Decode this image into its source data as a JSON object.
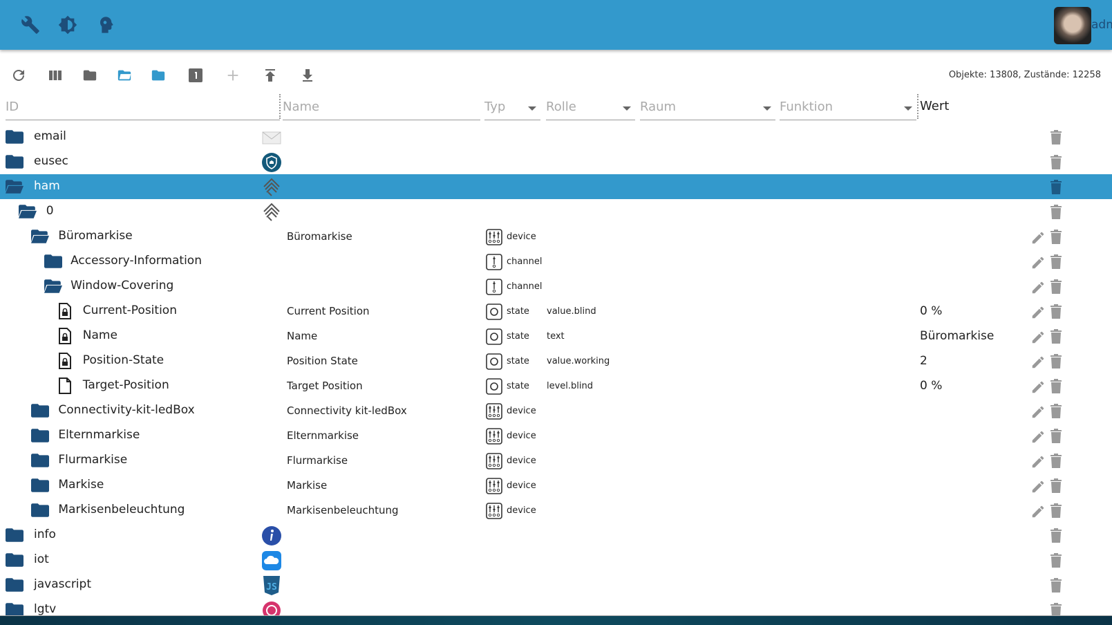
{
  "header": {
    "user": "adm",
    "icons": [
      "wrench-icon",
      "brightness-icon",
      "expert-mode-icon"
    ]
  },
  "toolbar": {
    "buttons": [
      "refresh",
      "columns",
      "collapse-all",
      "expand-all",
      "expand-one",
      "numbering",
      "add",
      "upload",
      "download"
    ],
    "stats": "Objekte: 13808, Zustände: 12258"
  },
  "filters": {
    "id": "ID",
    "name": "Name",
    "type": "Typ",
    "role": "Rolle",
    "room": "Raum",
    "function": "Funktion",
    "value": "Wert"
  },
  "colors": {
    "accent": "#3399cc",
    "folder": "#1d4e7a"
  },
  "rows": [
    {
      "id": "email",
      "level": 0,
      "icon": "folder",
      "adapter": "email",
      "editable": false
    },
    {
      "id": "eusec",
      "level": 0,
      "icon": "folder",
      "adapter": "eusec",
      "editable": false
    },
    {
      "id": "ham",
      "level": 0,
      "icon": "folder-open",
      "adapter": "ham",
      "selected": true,
      "editable": false
    },
    {
      "id": "0",
      "level": 1,
      "icon": "folder-open",
      "adapter": "ham",
      "editable": false
    },
    {
      "id": "Büromarkise",
      "level": 2,
      "icon": "folder-open",
      "name": "Büromarkise",
      "type": "device",
      "editable": true
    },
    {
      "id": "Accessory-Information",
      "level": 3,
      "icon": "folder",
      "type": "channel",
      "editable": true
    },
    {
      "id": "Window-Covering",
      "level": 3,
      "icon": "folder-open",
      "type": "channel",
      "editable": true
    },
    {
      "id": "Current-Position",
      "level": 4,
      "icon": "file-lock",
      "name": "Current Position",
      "type": "state",
      "role": "value.blind",
      "value": "0 %",
      "editable": true
    },
    {
      "id": "Name",
      "level": 4,
      "icon": "file-lock",
      "name": "Name",
      "type": "state",
      "role": "text",
      "value": "Büromarkise",
      "editable": true
    },
    {
      "id": "Position-State",
      "level": 4,
      "icon": "file-lock",
      "name": "Position State",
      "type": "state",
      "role": "value.working",
      "value": "2",
      "editable": true
    },
    {
      "id": "Target-Position",
      "level": 4,
      "icon": "file",
      "name": "Target Position",
      "type": "state",
      "role": "level.blind",
      "value": "0 %",
      "editable": true
    },
    {
      "id": "Connectivity-kit-ledBox",
      "level": 2,
      "icon": "folder",
      "name": "Connectivity kit-ledBox",
      "type": "device",
      "editable": true
    },
    {
      "id": "Elternmarkise",
      "level": 2,
      "icon": "folder",
      "name": "Elternmarkise",
      "type": "device",
      "editable": true
    },
    {
      "id": "Flurmarkise",
      "level": 2,
      "icon": "folder",
      "name": "Flurmarkise",
      "type": "device",
      "editable": true
    },
    {
      "id": "Markise",
      "level": 2,
      "icon": "folder",
      "name": "Markise",
      "type": "device",
      "editable": true
    },
    {
      "id": "Markisenbeleuchtung",
      "level": 2,
      "icon": "folder",
      "name": "Markisenbeleuchtung",
      "type": "device",
      "editable": true
    },
    {
      "id": "info",
      "level": 0,
      "icon": "folder",
      "adapter": "info",
      "editable": false
    },
    {
      "id": "iot",
      "level": 0,
      "icon": "folder",
      "adapter": "iot",
      "editable": false
    },
    {
      "id": "javascript",
      "level": 0,
      "icon": "folder",
      "adapter": "javascript",
      "editable": false
    },
    {
      "id": "lgtv",
      "level": 0,
      "icon": "folder",
      "adapter": "lgtv",
      "editable": false
    }
  ]
}
